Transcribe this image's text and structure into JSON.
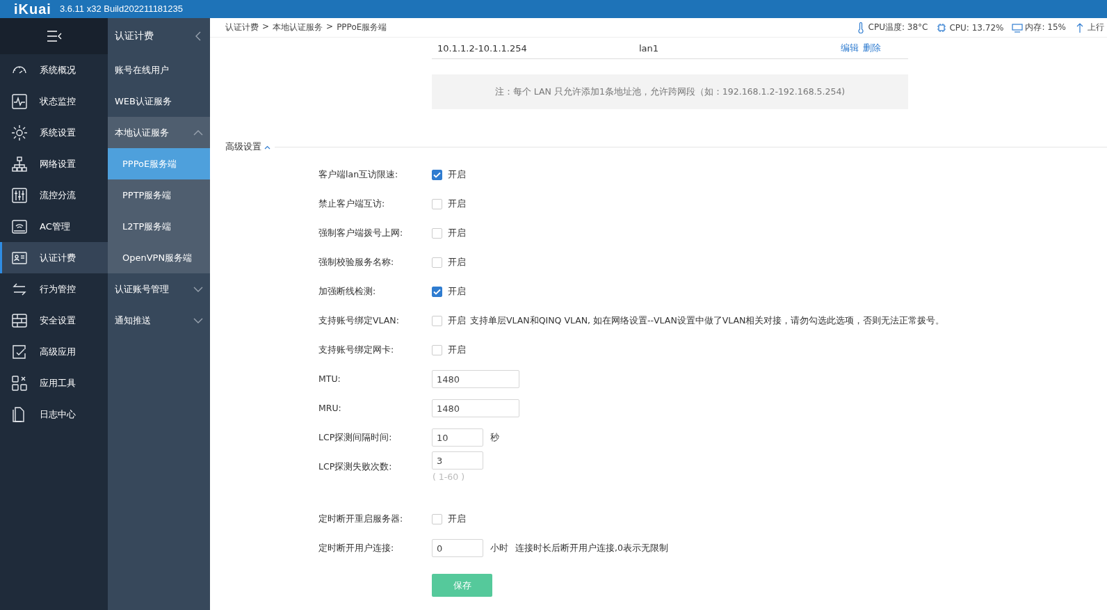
{
  "header": {
    "logo": "iKuai",
    "version": "3.6.11 x32 Build202211181235"
  },
  "sidebar": {
    "items": [
      {
        "label": "系统概况",
        "selected": false
      },
      {
        "label": "状态监控",
        "selected": false
      },
      {
        "label": "系统设置",
        "selected": false
      },
      {
        "label": "网络设置",
        "selected": false
      },
      {
        "label": "流控分流",
        "selected": false
      },
      {
        "label": "AC管理",
        "selected": false
      },
      {
        "label": "认证计费",
        "selected": true
      },
      {
        "label": "行为管控",
        "selected": false
      },
      {
        "label": "安全设置",
        "selected": false
      },
      {
        "label": "高级应用",
        "selected": false
      },
      {
        "label": "应用工具",
        "selected": false
      },
      {
        "label": "日志中心",
        "selected": false
      }
    ]
  },
  "submenu": {
    "title": "认证计费",
    "items": [
      {
        "label": "账号在线用户"
      },
      {
        "label": "WEB认证服务"
      },
      {
        "label": "本地认证服务",
        "expanded": true,
        "children": [
          {
            "label": "PPPoE服务端",
            "selected": true
          },
          {
            "label": "PPTP服务端",
            "selected": false
          },
          {
            "label": "L2TP服务端",
            "selected": false
          },
          {
            "label": "OpenVPN服务端",
            "selected": false
          }
        ]
      },
      {
        "label": "认证账号管理",
        "expanded": false
      },
      {
        "label": "通知推送",
        "expanded": false
      }
    ]
  },
  "breadcrumb": [
    "认证计费",
    ">",
    "本地认证服务",
    ">",
    "PPPoE服务端"
  ],
  "status": [
    {
      "text": "CPU温度: 38°C"
    },
    {
      "text": "CPU: 13.72%"
    },
    {
      "text": "内存: 15%"
    },
    {
      "text": "上行"
    }
  ],
  "pool_table": {
    "rows": [
      {
        "range": "10.1.1.2-10.1.1.254",
        "interface": "lan1",
        "actions": [
          "编辑",
          "删除"
        ]
      }
    ]
  },
  "note": "注：每个 LAN 只允许添加1条地址池，允许跨网段（如：192.168.1.2-192.168.5.254)",
  "advanced": {
    "title": "高级设置",
    "expanded": true,
    "fields": [
      {
        "kind": "checkbox",
        "label": "客户端lan互访限速:",
        "checked": true,
        "option": "开启"
      },
      {
        "kind": "checkbox",
        "label": "禁止客户端互访:",
        "checked": false,
        "option": "开启"
      },
      {
        "kind": "checkbox",
        "label": "强制客户端拨号上网:",
        "checked": false,
        "option": "开启"
      },
      {
        "kind": "checkbox",
        "label": "强制校验服务名称:",
        "checked": false,
        "option": "开启"
      },
      {
        "kind": "checkbox",
        "label": "加强断线检测:",
        "checked": true,
        "option": "开启"
      },
      {
        "kind": "checkbox",
        "label": "支持账号绑定VLAN:",
        "checked": false,
        "option": "开启",
        "hint": "支持单层VLAN和QINQ VLAN, 如在网络设置--VLAN设置中做了VLAN相关对接，请勿勾选此选项，否则无法正常拨号。"
      },
      {
        "kind": "checkbox",
        "label": "支持账号绑定网卡:",
        "checked": false,
        "option": "开启"
      },
      {
        "kind": "input",
        "label": "MTU:",
        "value": "1480"
      },
      {
        "kind": "input",
        "label": "MRU:",
        "value": "1480"
      },
      {
        "kind": "short-input",
        "label": "LCP探测间隔时间:",
        "value": "10",
        "unit": "秒"
      },
      {
        "kind": "short-input",
        "label": "LCP探测失败次数:",
        "value": "3",
        "range": "( 1-60 )"
      },
      {
        "kind": "checkbox",
        "label": "定时断开重启服务器:",
        "checked": false,
        "option": "开启"
      },
      {
        "kind": "short-input",
        "label": "定时断开用户连接:",
        "value": "0",
        "unit": "小时",
        "hint": "连接时长后断开用户连接,0表示无限制"
      }
    ]
  },
  "save_button": "保存"
}
